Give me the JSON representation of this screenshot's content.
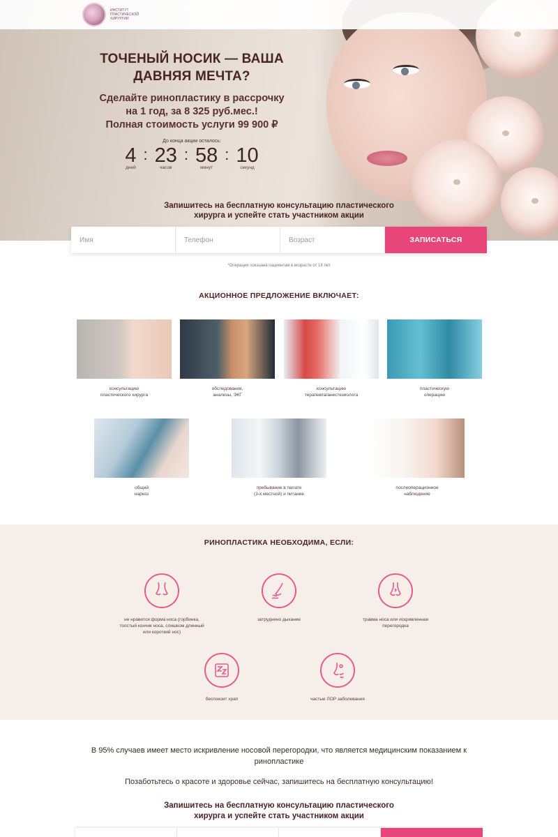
{
  "brand": {
    "logo_text": "Институт пластической хирургии"
  },
  "hero": {
    "title": "ТОЧЕНЫЙ НОСИК — ВАША ДАВНЯЯ МЕЧТА?",
    "subtitle_line1": "Сделайте ринопластику в рассрочку",
    "subtitle_line2": "на 1 год, за 8 325 руб.мес.!",
    "subtitle_line3": "Полная стоимость услуги 99 900 ₽",
    "countdown_label": "До конца акции осталось:",
    "countdown": {
      "days": "4",
      "days_unit": "дней",
      "hours": "23",
      "hours_unit": "часов",
      "minutes": "58",
      "minutes_unit": "минут",
      "seconds": "10",
      "seconds_unit": "секунд"
    },
    "cta_text": "Запишитесь на бесплатную консультацию пластического хирурга и успейте стать участником акции"
  },
  "form": {
    "name_placeholder": "Имя",
    "phone_placeholder": "Телефон",
    "age_placeholder": "Возраст",
    "submit_label": "ЗАПИСАТЬСЯ",
    "note": "*Операция показана пациентам в возрасте от 18 лет"
  },
  "offer": {
    "title": "АКЦИОННОЕ ПРЕДЛОЖЕНИЕ ВКЛЮЧАЕТ:",
    "items": [
      {
        "caption_line1": "консультацию",
        "caption_line2": "пластического хирурга"
      },
      {
        "caption_line1": "обследования,",
        "caption_line2": "анализы, ЭКГ"
      },
      {
        "caption_line1": "консультацию",
        "caption_line2": "терапевта/анестезиолога"
      },
      {
        "caption_line1": "пластическую",
        "caption_line2": "операцию"
      },
      {
        "caption_line1": "общий",
        "caption_line2": "наркоз"
      },
      {
        "caption_line1": "пребывание в палате",
        "caption_line2": "(3-х местной) и питание"
      },
      {
        "caption_line1": "послеоперационное",
        "caption_line2": "наблюдение"
      }
    ]
  },
  "indications": {
    "title": "РИНОПЛАСТИКА НЕОБХОДИМА, ЕСЛИ:",
    "items": [
      {
        "icon": "nose-profile-icon",
        "caption_line1": "не нравится форма носа (горбинка,",
        "caption_line2": "толстый кончик носа, слишком длинный",
        "caption_line3": "или короткий нос)"
      },
      {
        "icon": "nose-airflow-icon",
        "caption_line1": "затруднено дыхание",
        "caption_line2": "",
        "caption_line3": ""
      },
      {
        "icon": "nose-front-icon",
        "caption_line1": "травма носа или искривленная",
        "caption_line2": "перегородка",
        "caption_line3": ""
      },
      {
        "icon": "snoring-icon",
        "caption_line1": "беспокоит храп",
        "caption_line2": "",
        "caption_line3": ""
      },
      {
        "icon": "ent-disease-icon",
        "caption_line1": "частые ЛОР заболевания",
        "caption_line2": "",
        "caption_line3": ""
      }
    ]
  },
  "bottom": {
    "fact": "В 95% случаев имеет место искривление носовой перегородки, что является медицинским показанием к ринопластике",
    "care": "Позаботьтесь о красоте и здоровье сейчас, запишитесь на бесплатную консультацию!",
    "cta_text": "Запишитесь на бесплатную консультацию пластического хирурга и успейте стать участником акции"
  },
  "colors": {
    "accent": "#e8467a",
    "icon_stroke": "#e85a8c",
    "section_bg": "#f6eee8",
    "heading": "#4a2323"
  }
}
